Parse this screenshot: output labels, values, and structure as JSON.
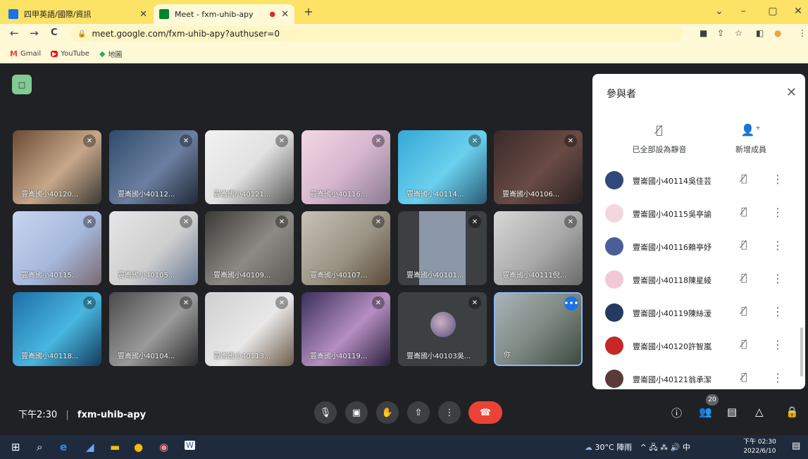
{
  "browser": {
    "tabs": [
      {
        "title": "四甲英語/國際/資訊",
        "favicon_color": "#1a73e8"
      },
      {
        "title": "Meet - fxm-uhib-apy",
        "favicon_color": "#00832d"
      }
    ],
    "new_tab": "+",
    "window": {
      "minimize": "–",
      "restore": "▢",
      "close": "✕",
      "tabsearch": "⌄"
    },
    "url": "meet.google.com/fxm-uhib-apy?authuser=0",
    "bookmarks": [
      {
        "label": "Gmail",
        "icon": "M"
      },
      {
        "label": "YouTube",
        "icon": "▶"
      },
      {
        "label": "地圖",
        "icon": "◆"
      }
    ]
  },
  "meet": {
    "badge": "□",
    "tiles": [
      {
        "name": "豐崙國小40120...",
        "bg": "linear-gradient(135deg,#6b4a34,#c6a78a 55%,#3d3a35)"
      },
      {
        "name": "豐崙國小40112...",
        "bg": "linear-gradient(135deg,#2e4b6b,#6c7fa0 55%,#1f2836)"
      },
      {
        "name": "豐崙國小40121...",
        "bg": "linear-gradient(135deg,#f2f2f2,#e2e2e2 50%,#5a5a5a)"
      },
      {
        "name": "豐崙國小40116...",
        "bg": "linear-gradient(135deg,#f3d7e3,#d7b7cf 50%,#8a7b92)"
      },
      {
        "name": "豐崙國小40114...",
        "bg": "linear-gradient(135deg,#35a8d6,#6ad0ee 55%,#2a5a75)"
      },
      {
        "name": "豐崙國小40106...",
        "bg": "linear-gradient(135deg,#3a2a28,#6a4b45 55%,#2a2222)"
      },
      {
        "name": "豐崙國小40115...",
        "bg": "linear-gradient(135deg,#c7d5ef,#a6b8dc 55%,#7a6a70)"
      },
      {
        "name": "豐崙國小40105...",
        "bg": "linear-gradient(135deg,#e6e6e6,#cfcfcf 55%,#6b7a94)"
      },
      {
        "name": "豐崙國小40109...",
        "bg": "linear-gradient(135deg,#3b3a36,#8c8a85 55%,#5c5a55)"
      },
      {
        "name": "豐崙國小40107...",
        "bg": "linear-gradient(135deg,#c8c3b6,#9a9384 55%,#5a4a3a)"
      },
      {
        "name": "豐崙國小40101...",
        "bg": "linear-gradient(90deg,#3c4043 0 24%,#8c98a8 24% 76%,#3c4043 76%)"
      },
      {
        "name": "豐崙國小40111倪...",
        "bg": "linear-gradient(135deg,#d8d8d8,#a9a9a9 55%,#6a6a6a)"
      },
      {
        "name": "豐崙國小40118...",
        "bg": "linear-gradient(135deg,#1e6fa8,#48b6e0 55%,#143a5a)"
      },
      {
        "name": "豐崙國小40104...",
        "bg": "linear-gradient(135deg,#4b4b4b,#9a9a9a 55%,#2a2a2a)"
      },
      {
        "name": "豐崙國小40113...",
        "bg": "linear-gradient(135deg,#cfcfcf,#e8e8e8 55%,#6c5a4a)"
      },
      {
        "name": "豐崙國小40119...",
        "bg": "linear-gradient(135deg,#3b2f5a,#b58fc2 55%,#2a1f3a)"
      },
      {
        "name": "豐崙國小40103吳...",
        "bg": "#3c4043",
        "avatar": true
      },
      {
        "name": "你",
        "bg": "linear-gradient(135deg,#aab3b9,#7f8a83 50%,#3c4a3f)",
        "self": true
      }
    ],
    "mute_icon": "🎤̸",
    "self_more": "•••"
  },
  "panel": {
    "title": "參與者",
    "close": "✕",
    "actions": [
      {
        "label": "已全部設為靜音",
        "icon": "mic-off-icon",
        "glyph": "🎙"
      },
      {
        "label": "新增成員",
        "icon": "add-person-icon",
        "glyph": "👤+"
      }
    ],
    "participants": [
      {
        "name": "豐崙國小40114吳佳芸",
        "avatar": "#2f4a7a"
      },
      {
        "name": "豐崙國小40115吳亭諭",
        "avatar": "#f3d6de"
      },
      {
        "name": "豐崙國小40116賴亭妤",
        "avatar": "#4a5f9a"
      },
      {
        "name": "豐崙國小40118陳星綾",
        "avatar": "#f1c9d6"
      },
      {
        "name": "豐崙國小40119陳絲湲",
        "avatar": "#233a63"
      },
      {
        "name": "豐崙國小40120許智嵐",
        "avatar": "#c62828"
      },
      {
        "name": "豐崙國小40121翁承潔",
        "avatar": "#5b3a3a"
      }
    ],
    "row_mute": "🎙",
    "row_more": "⋮"
  },
  "bottombar": {
    "time": "下午2:30",
    "separator": "|",
    "meeting_code": "fxm-uhib-apy",
    "controls": [
      {
        "name": "microphone-button",
        "glyph": "🎙"
      },
      {
        "name": "camera-button",
        "glyph": "▣"
      },
      {
        "name": "raise-hand-button",
        "glyph": "✋"
      },
      {
        "name": "present-button",
        "glyph": "⇧"
      },
      {
        "name": "more-options-button",
        "glyph": "⋮"
      },
      {
        "name": "leave-call-button",
        "glyph": "☎"
      }
    ],
    "right": [
      {
        "name": "meeting-details-button",
        "glyph": "ⓘ"
      },
      {
        "name": "people-button",
        "glyph": "👥"
      },
      {
        "name": "chat-button",
        "glyph": "💬"
      },
      {
        "name": "activities-button",
        "glyph": "△"
      },
      {
        "name": "host-controls-button",
        "glyph": "🔒"
      }
    ],
    "people_count": "20"
  },
  "taskbar": {
    "weather": "30°C 陣雨",
    "sys_icons": "^ 🖧 ⁂ 🔊 中",
    "time": "下午 02:30",
    "date": "2022/6/10"
  }
}
